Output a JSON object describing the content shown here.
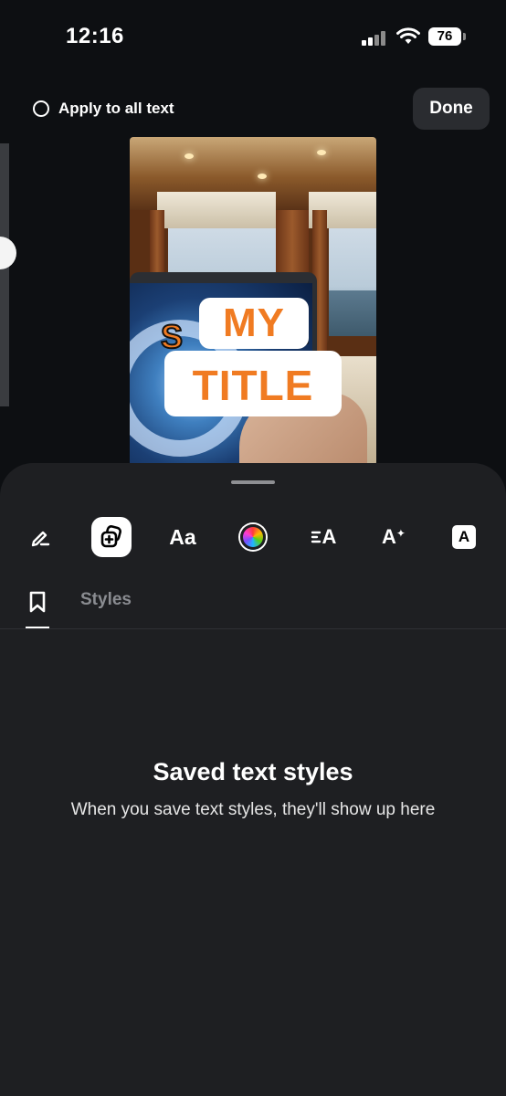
{
  "status_bar": {
    "time": "12:16",
    "battery": "76"
  },
  "header": {
    "apply_label": "Apply to all text",
    "done_label": "Done"
  },
  "preview": {
    "title_line1": "MY",
    "title_line2": "TITLE",
    "brand_color": "#f07b22"
  },
  "toolbar": {
    "tools": [
      {
        "name": "edit-text",
        "icon": "pencil-icon"
      },
      {
        "name": "styles",
        "icon": "sticker-add-icon",
        "selected": true
      },
      {
        "name": "font",
        "icon": "font-aa-icon",
        "label": "Aa"
      },
      {
        "name": "color",
        "icon": "color-wheel-icon"
      },
      {
        "name": "alignment",
        "icon": "align-text-icon",
        "label": "A"
      },
      {
        "name": "effects",
        "icon": "text-sparkle-icon",
        "label": "A"
      },
      {
        "name": "background",
        "icon": "text-background-icon",
        "label": "A"
      }
    ]
  },
  "tabs": {
    "styles_label": "Styles"
  },
  "empty_state": {
    "title": "Saved text styles",
    "subtitle": "When you save text styles, they'll show up here"
  }
}
